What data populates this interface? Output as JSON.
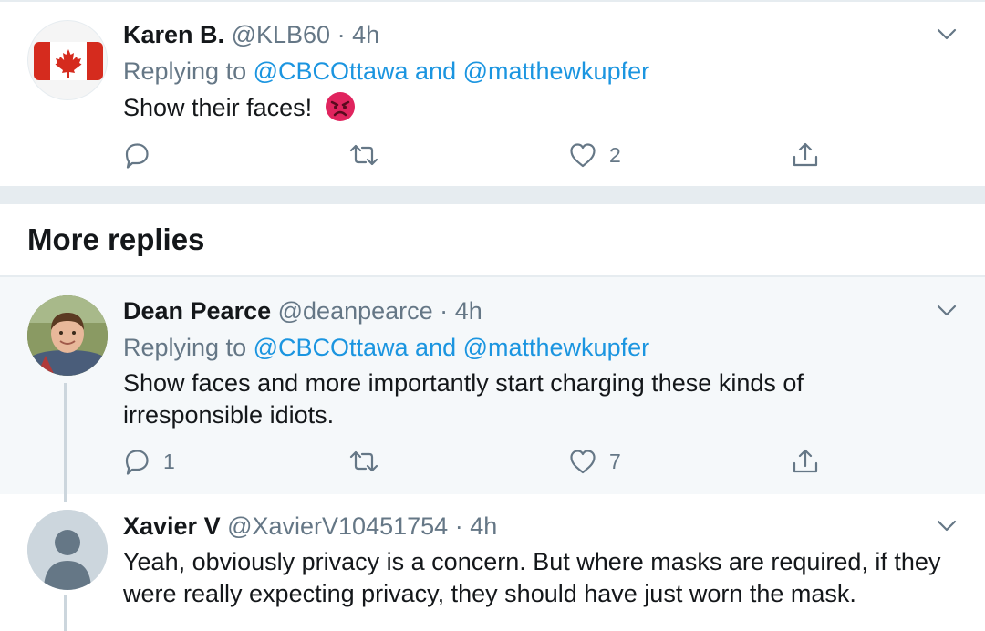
{
  "tweets": [
    {
      "name": "Karen B.",
      "handle": "@KLB60",
      "time": "4h",
      "replying_prefix": "Replying to ",
      "replying_to_1": "@CBCOttawa",
      "replying_and": " and ",
      "replying_to_2": "@matthewkupfer",
      "text": "Show their faces!",
      "emoji": "angry-face",
      "replies": "",
      "retweets": "",
      "likes": "2",
      "avatar": "canada-flag"
    },
    {
      "name": "Dean Pearce",
      "handle": "@deanpearce",
      "time": "4h",
      "replying_prefix": "Replying to ",
      "replying_to_1": "@CBCOttawa",
      "replying_and": " and ",
      "replying_to_2": "@matthewkupfer",
      "text": "Show faces and more importantly start charging these kinds of irresponsible idiots.",
      "replies": "1",
      "retweets": "",
      "likes": "7",
      "avatar": "photo"
    },
    {
      "name": "Xavier V",
      "handle": "@XavierV10451754",
      "time": "4h",
      "text": "Yeah, obviously privacy is a concern. But where masks are required, if they were really expecting privacy, they should have just worn the mask.",
      "avatar": "default-profile"
    }
  ],
  "section_title": "More replies",
  "colors": {
    "accent": "#1b95e0",
    "muted": "#657786",
    "highlight_bg": "#f5f8fa",
    "divider": "#e6ecf0",
    "flag_red": "#d52b1e",
    "emoji_red": "#e0245e"
  }
}
